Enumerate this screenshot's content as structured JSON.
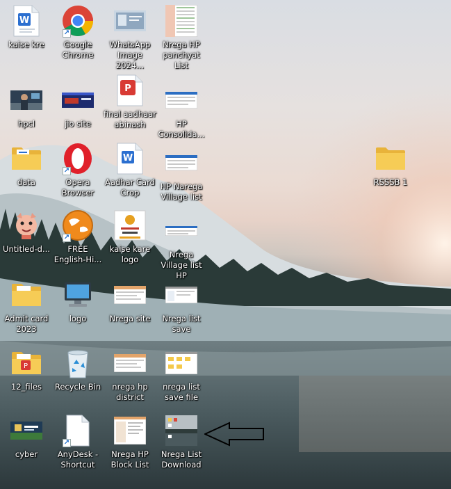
{
  "desktop": {
    "icons": [
      {
        "label": "kaise kre",
        "icon": "word-doc-icon"
      },
      {
        "label": "Google Chrome",
        "icon": "chrome-icon"
      },
      {
        "label": "WhatsApp Image 2024...",
        "icon": "image-thumbnail-icon"
      },
      {
        "label": "Nrega HP panchyat List",
        "icon": "spreadsheet-thumbnail-icon"
      },
      {
        "label": "hpcl",
        "icon": "photo-thumbnail-icon"
      },
      {
        "label": "jio site",
        "icon": "webpage-thumbnail-icon"
      },
      {
        "label": "final aadhaar abinash",
        "icon": "pdf-icon"
      },
      {
        "label": "HP Consolida...",
        "icon": "screenshot-thumbnail-icon"
      },
      {
        "label": "data",
        "icon": "folder-icon"
      },
      {
        "label": "Opera Browser",
        "icon": "opera-icon"
      },
      {
        "label": "Aadhar Card Crop",
        "icon": "word-doc-icon"
      },
      {
        "label": "HP Narega Village list",
        "icon": "screenshot-thumbnail-icon"
      },
      {
        "label": "RSSSB 1",
        "icon": "folder-icon"
      },
      {
        "label": "Untitled-d...",
        "icon": "cartoon-image-icon"
      },
      {
        "label": "FREE English-Hi...",
        "icon": "web-app-icon"
      },
      {
        "label": "kaise kare logo",
        "icon": "logo-thumbnail-icon"
      },
      {
        "label": "Nrega Village list HP",
        "icon": "screenshot-thumbnail-icon"
      },
      {
        "label": "Admit card 2023",
        "icon": "folder-icon"
      },
      {
        "label": "logo",
        "icon": "this-pc-icon"
      },
      {
        "label": "Nrega site",
        "icon": "webpage-thumbnail-icon"
      },
      {
        "label": "Nrega list save",
        "icon": "screenshot-thumbnail-icon"
      },
      {
        "label": "12_files",
        "icon": "folder-icon"
      },
      {
        "label": "Recycle Bin",
        "icon": "recycle-bin-icon"
      },
      {
        "label": "nrega hp district",
        "icon": "screenshot-thumbnail-icon"
      },
      {
        "label": "nrega list save file",
        "icon": "screenshot-thumbnail-icon"
      },
      {
        "label": "cyber",
        "icon": "photo-thumbnail-icon"
      },
      {
        "label": "AnyDesk - Shortcut",
        "icon": "blank-file-icon"
      },
      {
        "label": "Nrega HP Block List",
        "icon": "screenshot-thumbnail-icon"
      },
      {
        "label": "Nrega List Download",
        "icon": "desktop-thumbnail-icon"
      }
    ],
    "annotation": {
      "icon": "pointer-arrow-icon",
      "color": "#000000"
    }
  },
  "colors": {
    "folder": "#f4c94b",
    "word": "#2b6fd0",
    "pdf": "#d83a34",
    "opera": "#e0202a"
  }
}
